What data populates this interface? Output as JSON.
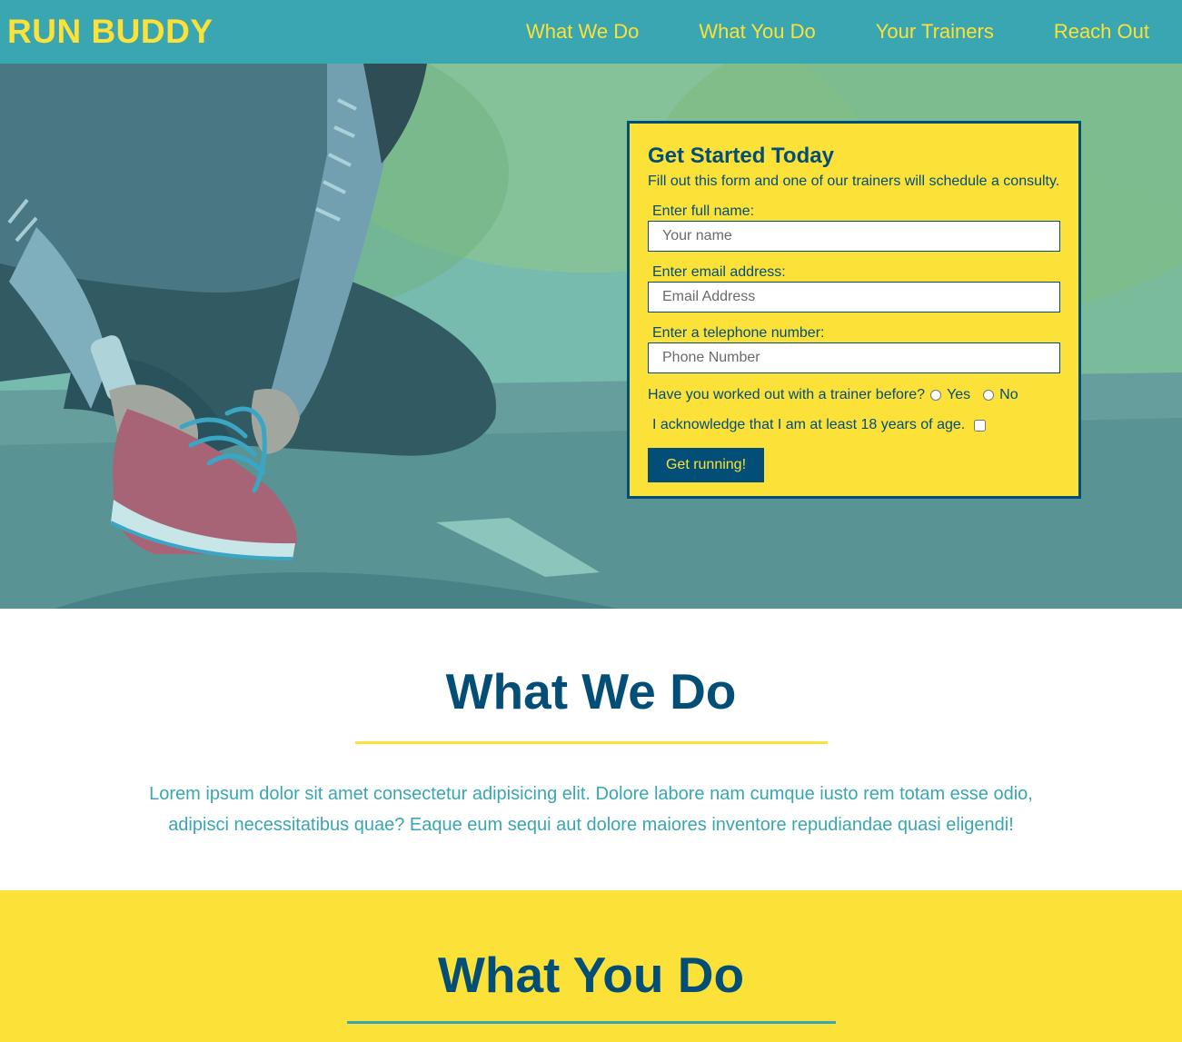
{
  "header": {
    "logo": "RUN BUDDY",
    "nav": [
      {
        "label": "What We Do"
      },
      {
        "label": "What You Do"
      },
      {
        "label": "Your Trainers"
      },
      {
        "label": "Reach Out"
      }
    ]
  },
  "form": {
    "title": "Get Started Today",
    "subtitle": "Fill out this form and one of our trainers will schedule a consulty.",
    "name_label": "Enter full name:",
    "name_placeholder": "Your name",
    "email_label": "Enter email address:",
    "email_placeholder": "Email Address",
    "phone_label": "Enter a telephone number:",
    "phone_placeholder": "Phone Number",
    "trainer_question": "Have you worked out with a trainer before?",
    "option_yes": "Yes",
    "option_no": "No",
    "age_acknowledge": "I acknowledge that I am at least 18 years of age.",
    "submit_label": "Get running!"
  },
  "what_we_do": {
    "heading": "What We Do",
    "body": "Lorem ipsum dolor sit amet consectetur adipisicing elit. Dolore labore nam cumque iusto rem totam esse odio, adipisci necessitatibus quae? Eaque eum sequi aut dolore maiores inventore repudiandae quasi eligendi!"
  },
  "what_you_do": {
    "heading": "What You Do"
  },
  "colors": {
    "primary_teal": "#39a6b2",
    "accent_yellow": "#fce138",
    "dark_blue": "#024e76"
  }
}
